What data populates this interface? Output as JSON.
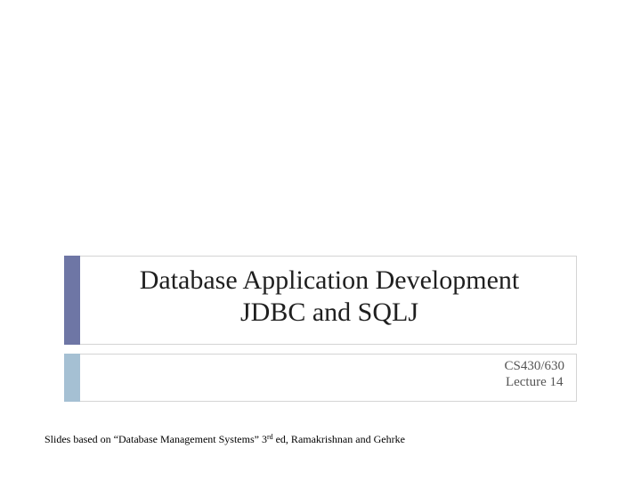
{
  "slide": {
    "title_line1": "Database Application Development",
    "title_line2": "JDBC and SQLJ",
    "subtitle_line1": "CS430/630",
    "subtitle_line2": "Lecture 14",
    "footnote_prefix": "Slides based on “Database Management Systems” 3",
    "footnote_sup": "rd",
    "footnote_suffix": " ed, Ramakrishnan and Gehrke"
  },
  "colors": {
    "title_accent": "#6e76a5",
    "subtitle_accent": "#a5c0d3"
  }
}
